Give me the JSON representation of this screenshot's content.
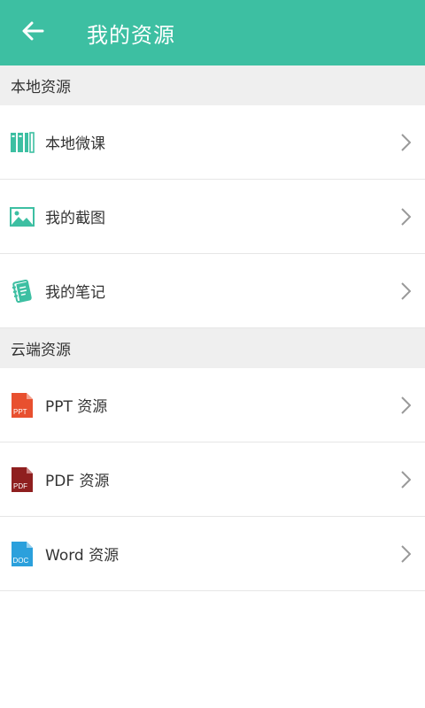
{
  "header": {
    "title": "我的资源",
    "back_icon": "arrow-left-icon"
  },
  "sections": [
    {
      "title": "本地资源",
      "items": [
        {
          "label": "本地微课",
          "icon": "books-icon",
          "color": "#3dbfa2"
        },
        {
          "label": "我的截图",
          "icon": "image-icon",
          "color": "#3dbfa2"
        },
        {
          "label": "我的笔记",
          "icon": "notebook-icon",
          "color": "#3dbfa2"
        }
      ]
    },
    {
      "title": "云端资源",
      "items": [
        {
          "label": "PPT 资源",
          "icon": "ppt-file-icon",
          "badge": "PPT",
          "color": "#e8502f"
        },
        {
          "label": "PDF 资源",
          "icon": "pdf-file-icon",
          "badge": "PDF",
          "color": "#8f1f1f"
        },
        {
          "label": "Word 资源",
          "icon": "doc-file-icon",
          "badge": "DOC",
          "color": "#2ba0dc"
        }
      ]
    }
  ],
  "colors": {
    "primary": "#3dbfa2",
    "section_bg": "#efefef",
    "divider": "#e6e6e6"
  }
}
